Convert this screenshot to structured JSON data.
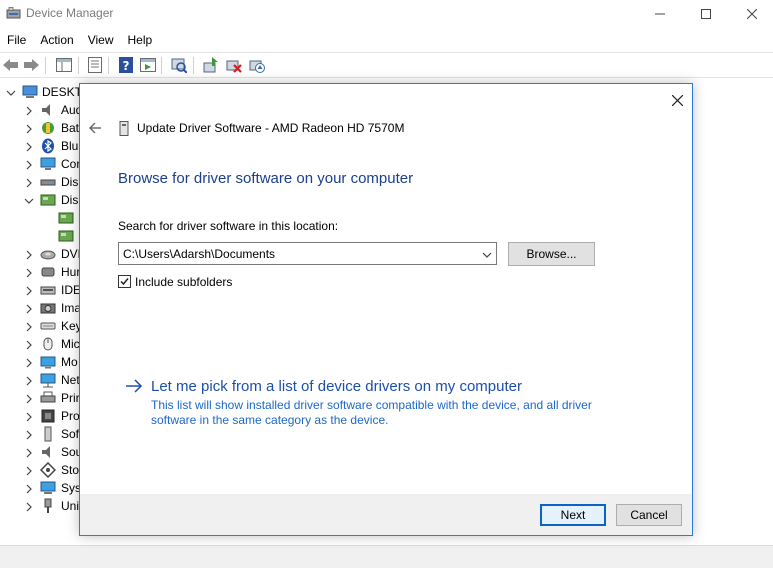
{
  "window": {
    "title": "Device Manager"
  },
  "menu": [
    "File",
    "Action",
    "View",
    "Help"
  ],
  "tree": {
    "root": "DESKTC",
    "items": [
      "Aud",
      "Bat",
      "Blu",
      "Cor",
      "Disl",
      "Disp",
      "",
      "",
      "DVD",
      "Hur",
      "IDE",
      "Ima",
      "Key",
      "Mic",
      "Mo",
      "Net",
      "Prir",
      "Pro",
      "Sof",
      "Sou",
      "Sto",
      "Syst",
      "Uni"
    ]
  },
  "dialog": {
    "title": "Update Driver Software - AMD Radeon HD 7570M",
    "heading": "Browse for driver software on your computer",
    "search_label": "Search for driver software in this location:",
    "path_value": "C:\\Users\\Adarsh\\Documents",
    "browse_label": "Browse...",
    "include_subfolders_label": "Include subfolders",
    "include_subfolders_checked": true,
    "pick_link": "Let me pick from a list of device drivers on my computer",
    "pick_desc": "This list will show installed driver software compatible with the device, and all driver software in the same category as the device.",
    "next_label": "Next",
    "cancel_label": "Cancel"
  },
  "colors": {
    "accent": "#2b7bd9",
    "heading": "#1c3f8c",
    "link": "#1c4faa",
    "link_desc": "#1c68c9"
  }
}
